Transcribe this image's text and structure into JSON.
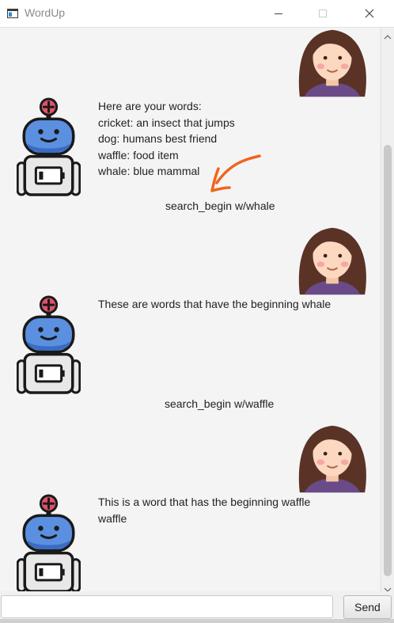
{
  "window": {
    "title": "WordUp",
    "icon": "app-window-icon",
    "controls": [
      "minimize-icon",
      "maximize-icon",
      "close-icon"
    ]
  },
  "conversation": [
    {
      "sender": "user",
      "avatar": "girl-avatar-icon",
      "text": ""
    },
    {
      "sender": "bot",
      "avatar": "robot-avatar-icon",
      "lines": [
        "Here are your words:",
        "cricket: an insect that jumps",
        "dog: humans best friend",
        "waffle: food item",
        "whale: blue mammal"
      ]
    },
    {
      "sender": "user",
      "avatar": "girl-avatar-icon",
      "text": "search_begin w/whale"
    },
    {
      "sender": "bot",
      "avatar": "robot-avatar-icon",
      "lines": [
        "These are words that have the beginning whale"
      ]
    },
    {
      "sender": "user",
      "avatar": "girl-avatar-icon",
      "text": "search_begin w/waffle"
    },
    {
      "sender": "bot",
      "avatar": "robot-avatar-icon",
      "lines": [
        "This is a word that has the beginning waffle",
        "waffle"
      ]
    }
  ],
  "annotation": {
    "icon": "orange-arrow-icon",
    "color": "#f0641e"
  },
  "input": {
    "value": "",
    "placeholder": ""
  },
  "send_label": "Send"
}
